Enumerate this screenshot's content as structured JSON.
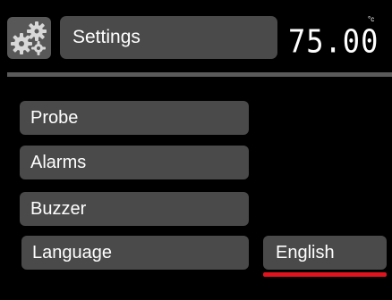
{
  "header": {
    "title": "Settings",
    "icon": "gear-icon",
    "temperature": "75.00",
    "temperature_unit": "°c"
  },
  "menu": {
    "items": [
      {
        "label": "Probe"
      },
      {
        "label": "Alarms"
      },
      {
        "label": "Buzzer"
      },
      {
        "label": "Language"
      }
    ]
  },
  "language": {
    "value": "English",
    "selected_underline_color": "#e0141e"
  },
  "colors": {
    "background": "#000000",
    "panel": "#4a4a4a",
    "accent": "#e0141e"
  }
}
